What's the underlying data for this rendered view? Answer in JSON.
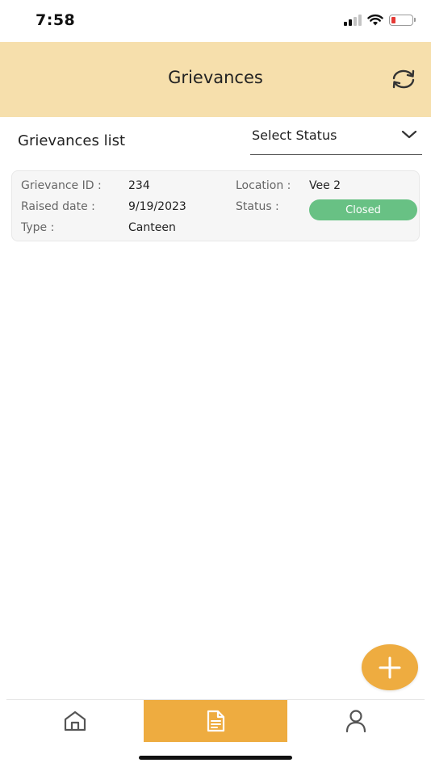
{
  "status_bar": {
    "time": "7:58",
    "icons": [
      "signal-icon",
      "wifi-icon",
      "battery-icon"
    ],
    "battery_color": "#e53935"
  },
  "header": {
    "title": "Grievances",
    "background": "#f6dfac",
    "refresh_icon": "refresh-icon"
  },
  "list": {
    "title": "Grievances list",
    "status_filter": {
      "selected": "Select Status",
      "icon": "chevron-down-icon"
    }
  },
  "grievances": [
    {
      "id_label": "Grievance ID :",
      "id": "234",
      "location_label": "Location :",
      "location": "Vee 2",
      "raised_label": "Raised date :",
      "raised_date": "9/19/2023",
      "status_label": "Status :",
      "status": "Closed",
      "status_color": "#68c184",
      "type_label": "Type :",
      "type": "Canteen"
    }
  ],
  "fab": {
    "icon": "plus-icon",
    "color": "#eeac40"
  },
  "bottom_nav": {
    "active_color": "#eeac40",
    "items": [
      {
        "icon": "home-icon",
        "active": false
      },
      {
        "icon": "document-icon",
        "active": true
      },
      {
        "icon": "profile-icon",
        "active": false
      }
    ]
  }
}
